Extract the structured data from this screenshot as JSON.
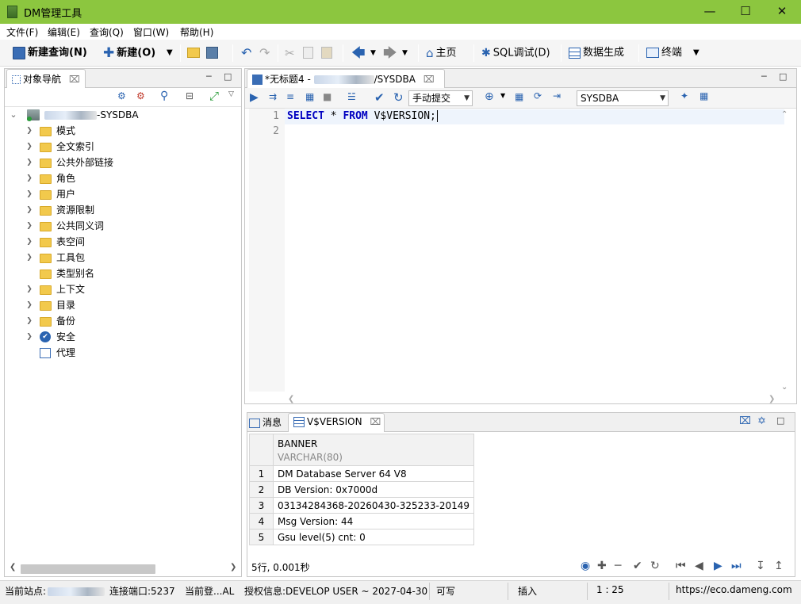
{
  "window": {
    "title": "DM管理工具"
  },
  "menu": [
    "文件(F)",
    "编辑(E)",
    "查询(Q)",
    "窗口(W)",
    "帮助(H)"
  ],
  "toolbar": {
    "new_query": "新建查询(N)",
    "new": "新建(O)",
    "home": "主页",
    "sql_debug": "SQL调试(D)",
    "data_gen": "数据生成",
    "terminal": "终端"
  },
  "nav": {
    "title": "对象导航",
    "root_suffix": "-SYSDBA",
    "items": [
      {
        "label": "模式",
        "icon": "folder-icon",
        "expandable": true
      },
      {
        "label": "全文索引",
        "icon": "folder-icon",
        "expandable": true
      },
      {
        "label": "公共外部链接",
        "icon": "folder-icon",
        "expandable": true
      },
      {
        "label": "角色",
        "icon": "folder-icon",
        "expandable": true
      },
      {
        "label": "用户",
        "icon": "folder-icon",
        "expandable": true
      },
      {
        "label": "资源限制",
        "icon": "folder-icon",
        "expandable": true
      },
      {
        "label": "公共同义词",
        "icon": "folder-icon",
        "expandable": true
      },
      {
        "label": "表空间",
        "icon": "folder-icon",
        "expandable": true
      },
      {
        "label": "工具包",
        "icon": "folder-icon",
        "expandable": true
      },
      {
        "label": "类型别名",
        "icon": "folder-icon",
        "expandable": false
      },
      {
        "label": "上下文",
        "icon": "folder-icon",
        "expandable": true
      },
      {
        "label": "目录",
        "icon": "folder-icon",
        "expandable": true
      },
      {
        "label": "备份",
        "icon": "folder-icon",
        "expandable": true
      },
      {
        "label": "安全",
        "icon": "shield-check-icon",
        "expandable": true
      },
      {
        "label": "代理",
        "icon": "proxy-icon",
        "expandable": false
      }
    ]
  },
  "editor": {
    "tab_prefix": "*无标题4 - ",
    "tab_suffix": "/SYSDBA",
    "commit_mode": "手动提交",
    "schema": "SYSDBA",
    "lines": [
      "SELECT * FROM V$VERSION;",
      ""
    ],
    "line_numbers": [
      "1",
      "2"
    ]
  },
  "results": {
    "messages_tab": "消息",
    "result_tab": "V$VERSION",
    "column": {
      "name": "BANNER",
      "type": "VARCHAR(80)"
    },
    "rows": [
      {
        "n": "1",
        "v": "DM Database Server 64 V8"
      },
      {
        "n": "2",
        "v": "DB Version: 0x7000d"
      },
      {
        "n": "3",
        "v": "03134284368-20260430-325233-20149"
      },
      {
        "n": "4",
        "v": "Msg Version: 44"
      },
      {
        "n": "5",
        "v": "Gsu level(5) cnt: 0"
      }
    ],
    "summary": "5行, 0.001秒"
  },
  "status": {
    "site_label": "当前站点:",
    "port": "连接端口:5237",
    "login": "当前登...AL",
    "license": "授权信息:DEVELOP USER ~ 2027-04-30",
    "writable": "可写",
    "insert": "插入",
    "position": "1 : 25",
    "url": "https://eco.dameng.com"
  },
  "colors": {
    "title_bar": "#8cc63f",
    "keyword": "#0000c0"
  }
}
